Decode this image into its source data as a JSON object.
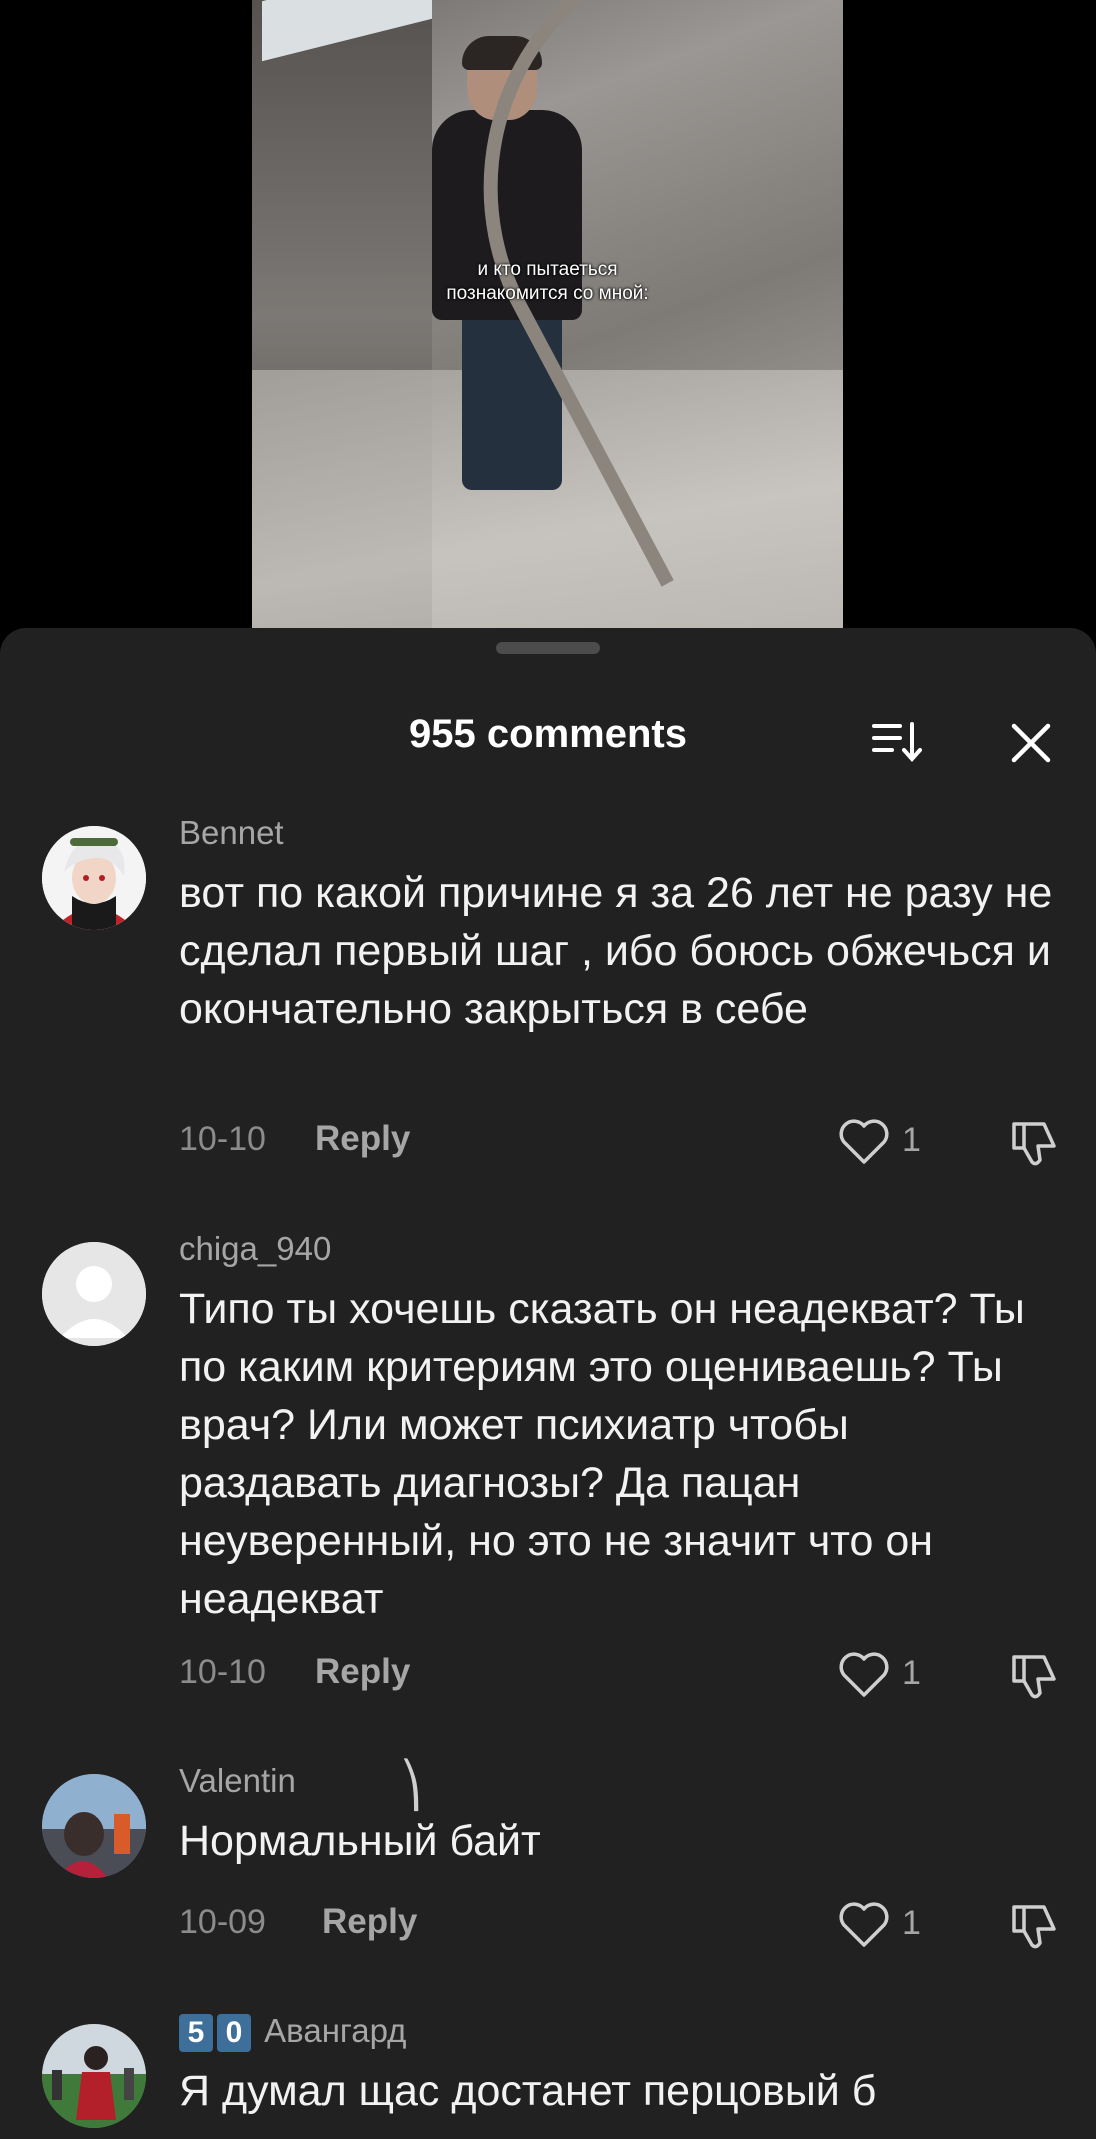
{
  "video": {
    "caption_line1": "и кто пытаеться",
    "caption_line2": "познакомится со мной:"
  },
  "sheet": {
    "title": "955 comments",
    "sort_icon": "sort-icon",
    "close_icon": "close-icon"
  },
  "comments": [
    {
      "username": "Bennet",
      "text": "вот по какой причине я за 26 лет не разу не сделал первый шаг , ибо боюсь обжечься и окончательно закрыться в себе",
      "date": "10-10",
      "reply": "Reply",
      "likes": "1"
    },
    {
      "username": "chiga_940",
      "text": "Типо ты хочешь сказать он неадекват? Ты по каким критериям это оцениваешь? Ты врач? Или может психиатр чтобы раздавать диагнозы? Да пацан неуверенный, но это не значит что он неадекват",
      "date": "10-10",
      "reply": "Reply",
      "likes": "1"
    },
    {
      "username": "Valentin",
      "decoration": "⎞",
      "text": "Нормальный байт",
      "date": "10-09",
      "reply": "Reply",
      "likes": "1"
    },
    {
      "badge1": "5",
      "badge2": "0",
      "username": "Авангард",
      "text": "Я думал щас достанет перцовый б"
    }
  ],
  "colors": {
    "sheet_bg": "#212121",
    "text": "#f2f2f2",
    "muted": "#a6a6a6"
  }
}
